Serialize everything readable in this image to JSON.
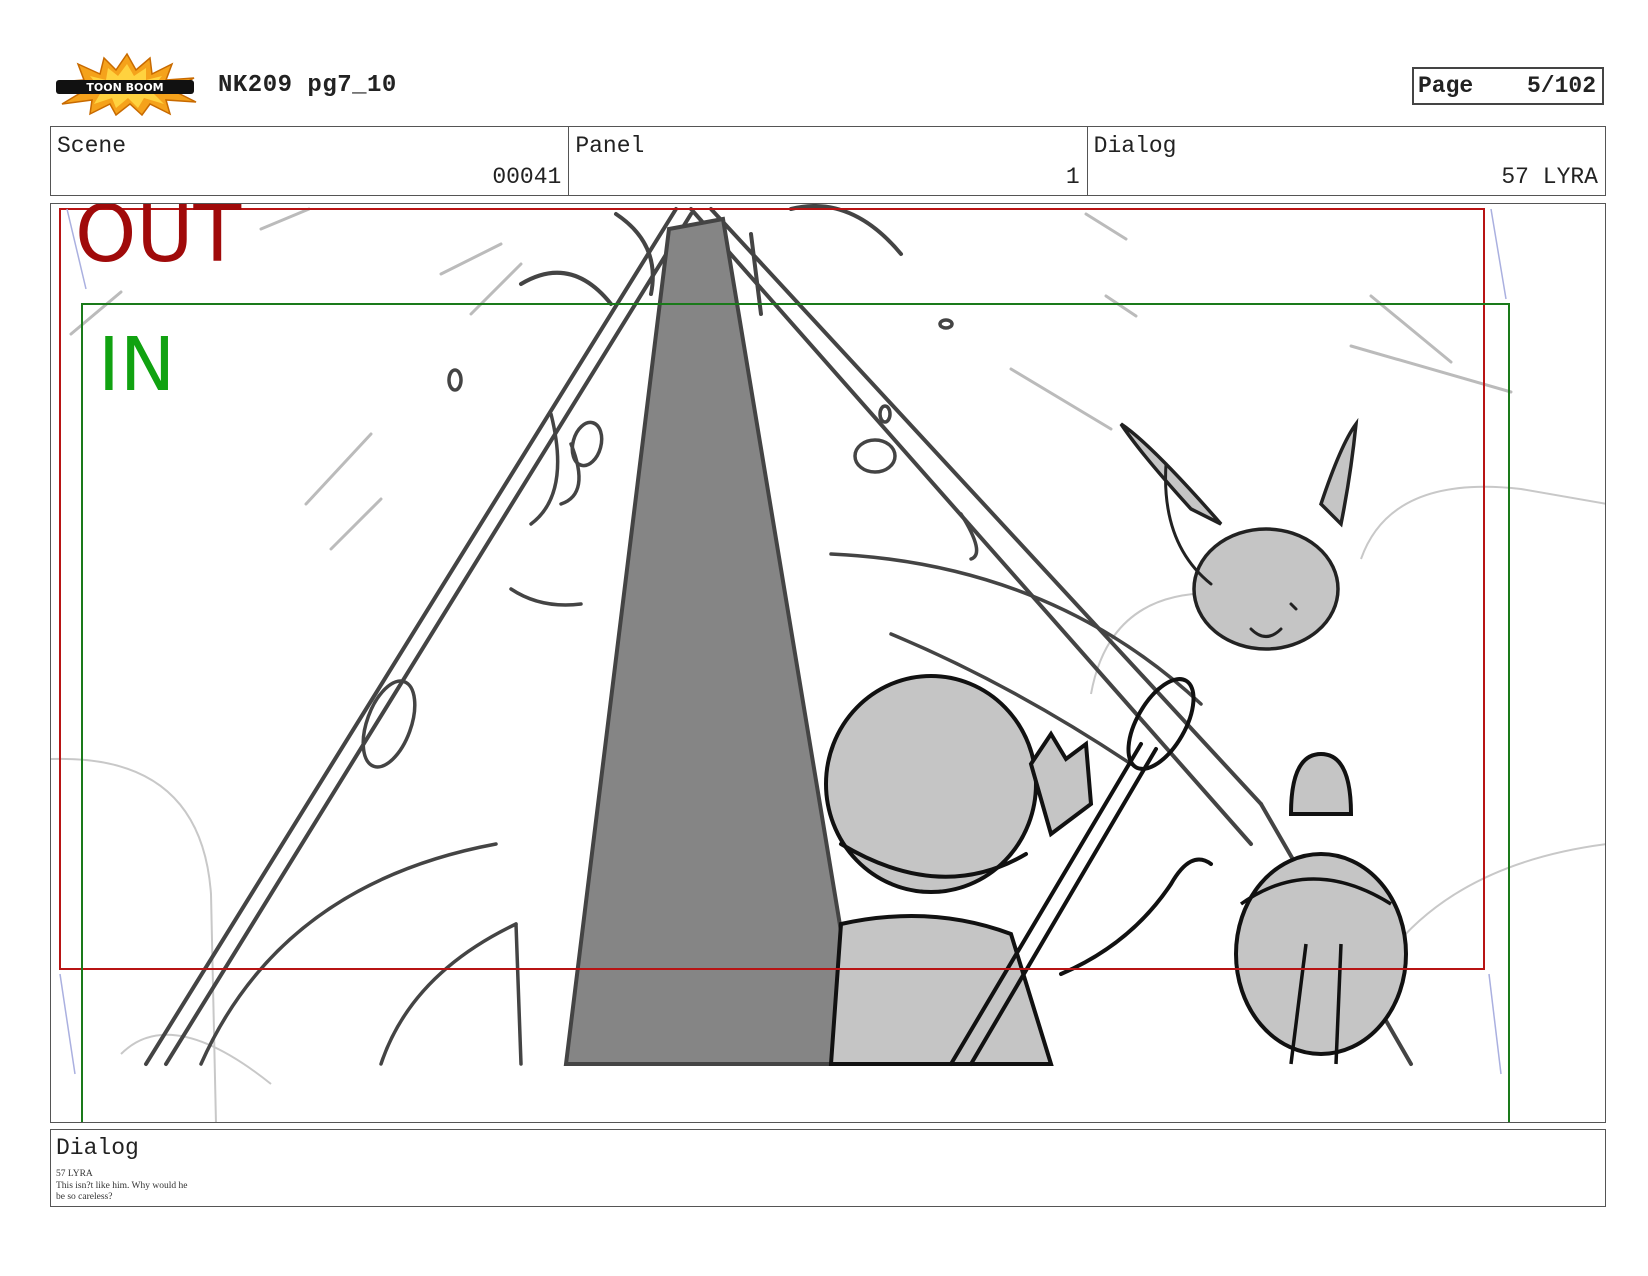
{
  "header": {
    "logo_text": "TOON BOOM",
    "title": "NK209 pg7_10",
    "page_label": "Page",
    "page_value": "5/102"
  },
  "info": {
    "scene_label": "Scene",
    "scene_value": "00041",
    "panel_label": "Panel",
    "panel_value": "1",
    "dialog_label": "Dialog",
    "dialog_value": "57 LYRA"
  },
  "panel_frame": {
    "out_label": "OUT",
    "in_label": "IN",
    "out_color": "#a00a0a",
    "in_color": "#11a211"
  },
  "dialog": {
    "label": "Dialog",
    "lines": [
      "57 LYRA",
      "This isn?t like him. Why would he",
      "be so careless?"
    ]
  }
}
